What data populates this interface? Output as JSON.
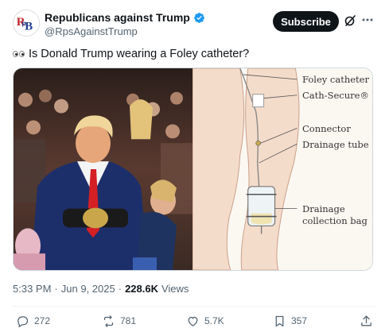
{
  "author": {
    "display_name": "Republicans against Trump",
    "handle": "@RpsAgainstTrump",
    "avatar_text": "RpB",
    "verified_icon": "verified-badge-icon"
  },
  "header": {
    "subscribe_label": "Subscribe"
  },
  "tweet": {
    "text": "Is Donald Trump wearing a Foley catheter?",
    "emoji_icon": "eyes-emoji-icon"
  },
  "media": {
    "left_image": "photo-trump-at-event-with-wrestler",
    "diagram_labels": {
      "foley": "Foley catheter",
      "cath_secure": "Cath-Secure®",
      "connector": "Connector",
      "drainage_tube": "Drainage tube",
      "bag_line1": "Drainage",
      "bag_line2": "collection bag"
    }
  },
  "meta": {
    "time": "5:33 PM",
    "separator": "·",
    "date": "Jun 9, 2025",
    "views_count": "228.6K",
    "views_label": "Views"
  },
  "actions": {
    "replies": "272",
    "reposts": "781",
    "likes": "5.7K",
    "bookmarks": "357"
  },
  "colors": {
    "accent_blue": "#1d9bf0",
    "text_primary": "#0f1419",
    "text_secondary": "#536471",
    "border": "#cfd9de"
  }
}
